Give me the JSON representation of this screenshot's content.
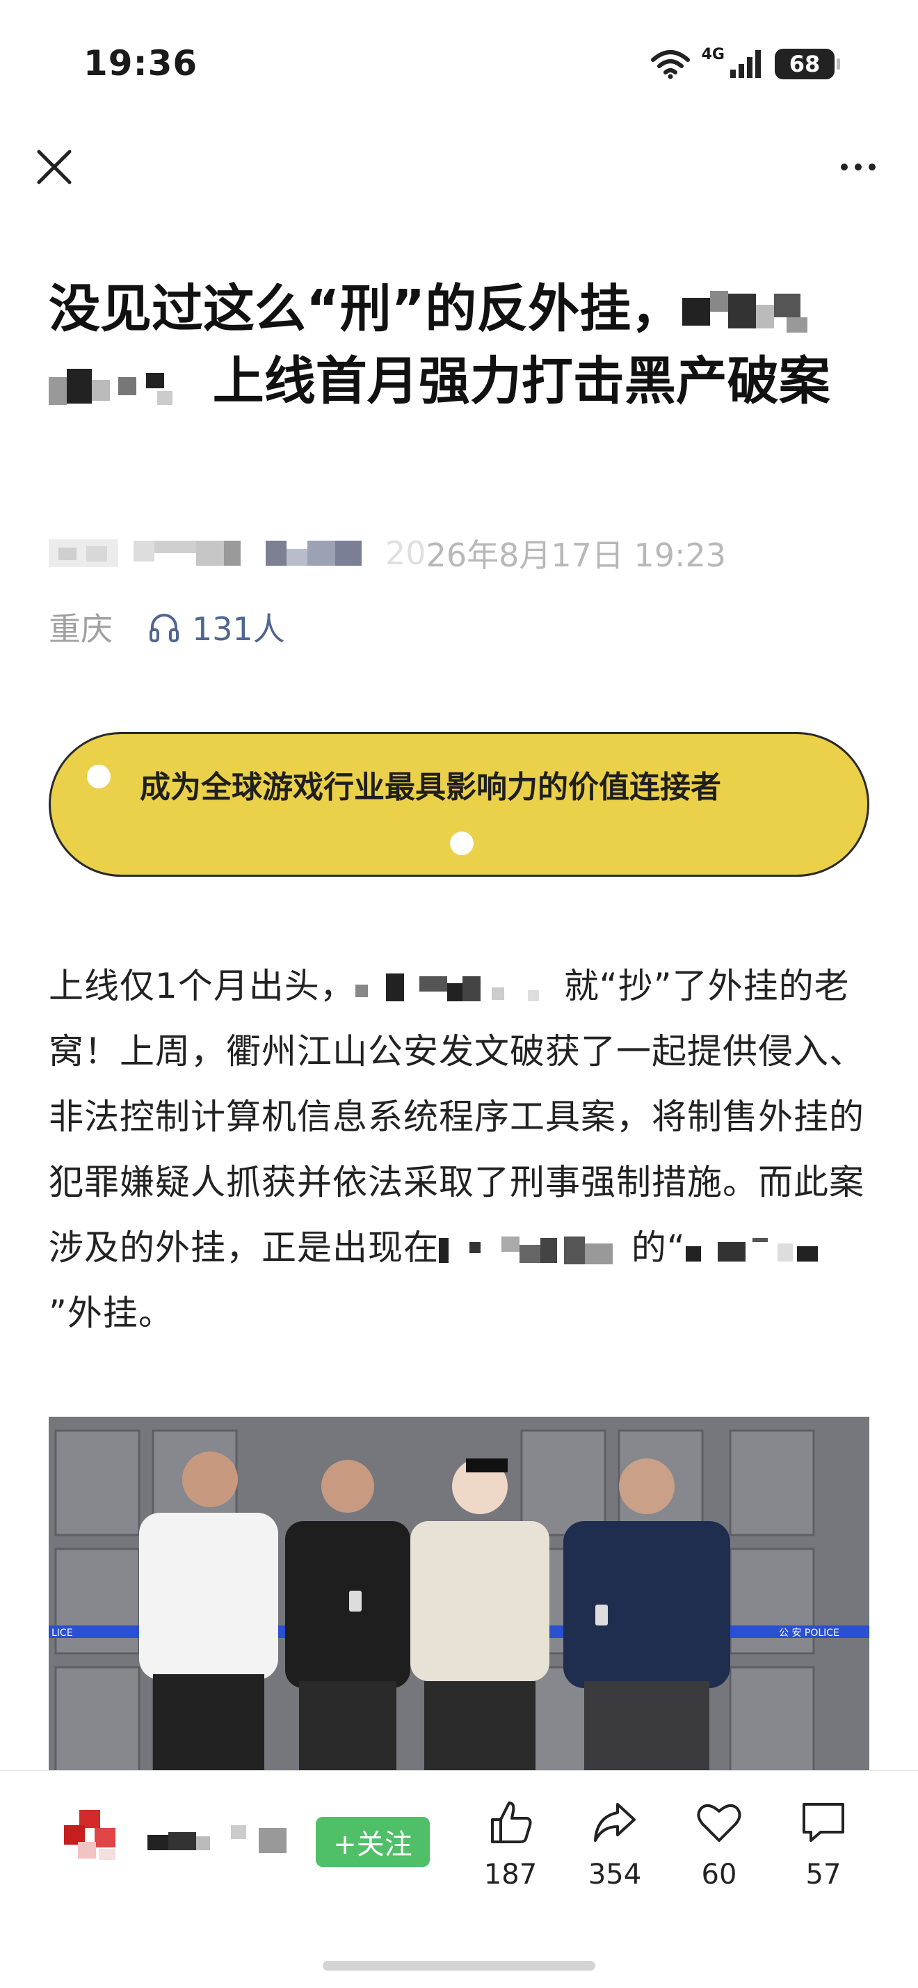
{
  "status_bar": {
    "time": "19:36",
    "network": "4G",
    "battery": "68"
  },
  "nav": {
    "close_icon": "close-icon",
    "more_icon": "more-horizontal-icon"
  },
  "article": {
    "title_part1": "没见过这么“刑”的反外挂，",
    "title_part2": "上线首月强力打击黑产破案",
    "date": "26年8月17日 19:23",
    "date_prefix": "20",
    "location": "重庆",
    "listen_count": "131人",
    "listen_icon": "headphones-icon"
  },
  "banner": {
    "text": "成为全球游戏行业最具影响力的价值连接者",
    "color": "#ebd04a"
  },
  "body": {
    "p1_a": "上线仅1个月出头，",
    "p1_b": "就“抄”了外挂的老窝！上周，衢州江山公安发文破获了一起提供侵入、非法控制计算机信息系统程序工具案，将制售外挂的犯罪嫌疑人抓获并依法采取了刑事强制措施。而此案涉及的外挂，正是出现在",
    "p1_c": "的“",
    "p1_d": "”外挂。"
  },
  "photo": {
    "police_tape_left": "LICE",
    "police_tape_right": "公 安 POLICE"
  },
  "bottom_bar": {
    "follow_label": "+关注",
    "follow_color": "#4fbf68",
    "actions": [
      {
        "name": "like",
        "icon": "thumbs-up-icon",
        "count": "187"
      },
      {
        "name": "share",
        "icon": "share-icon",
        "count": "354"
      },
      {
        "name": "favorite",
        "icon": "heart-icon",
        "count": "60"
      },
      {
        "name": "comment",
        "icon": "comment-icon",
        "count": "57"
      }
    ]
  }
}
